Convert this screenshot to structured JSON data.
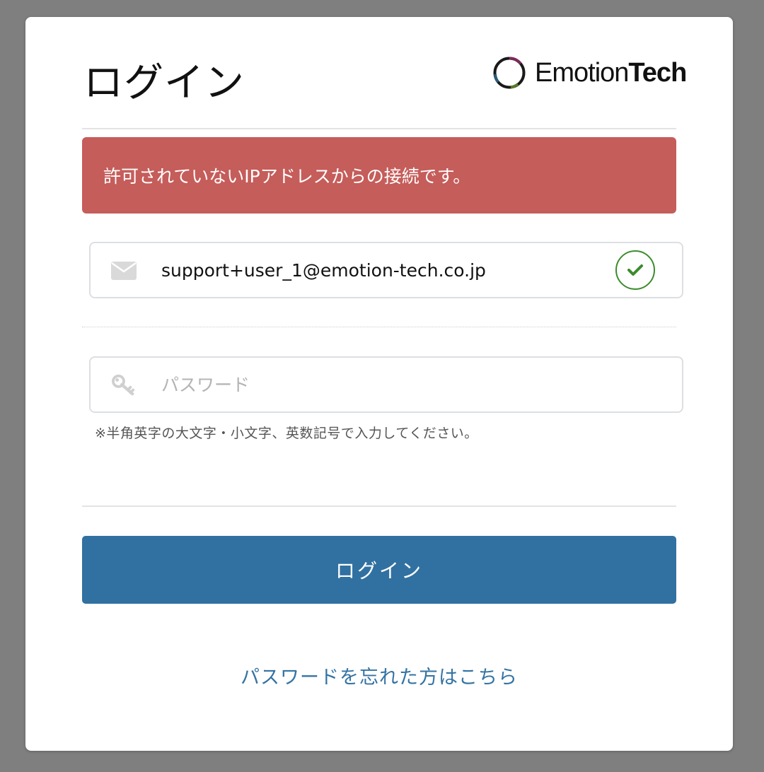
{
  "page": {
    "title": "ログイン"
  },
  "logo": {
    "text_regular": "Emotion",
    "text_bold": "Tech"
  },
  "alert": {
    "message": "許可されていないIPアドレスからの接続です。",
    "color": "#c55d5a"
  },
  "email_field": {
    "value": "support+user_1@emotion-tech.co.jp",
    "icon": "envelope-icon",
    "status_icon": "check-circle-icon"
  },
  "password_field": {
    "placeholder": "パスワード",
    "icon": "key-icon"
  },
  "password_hint": "※半角英字の大文字・小文字、英数記号で入力してください。",
  "login_button": {
    "label": "ログイン",
    "color": "#3171a1"
  },
  "forgot_link": {
    "label": "パスワードを忘れた方はこちら",
    "color": "#3473a3"
  }
}
